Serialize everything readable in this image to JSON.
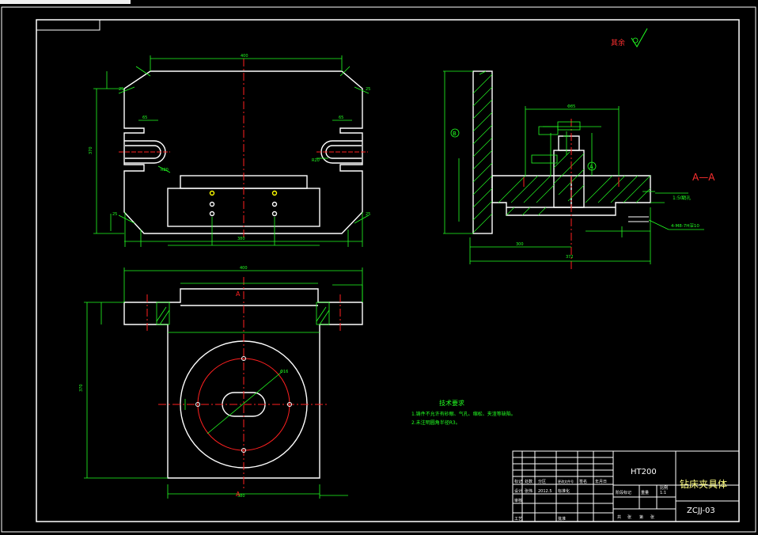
{
  "drawing": {
    "section_label": "A—A",
    "view_marker_a": "A",
    "datum_a": "A",
    "datum_b": "B",
    "surface_note": "其余",
    "ratio_note": "1:50",
    "thread_note": "4-M8-7H深10",
    "hole_note": "销孔",
    "tech_requirements": {
      "title": "技术要求",
      "lines": [
        "1.铸件不允许有砂眼、气孔、缩松、夹渣等缺陷。",
        "2.未注明圆角半径R3。"
      ]
    },
    "dims": {
      "top_width": "400",
      "dia": "Φ16",
      "r20": "R20",
      "d_left": "65",
      "d_right": "65",
      "w_bottom": "380",
      "h_left": "370",
      "section_len": "372",
      "section_sub": "300",
      "section_top": "Φ85",
      "r3": "R3",
      "r5": "R5",
      "c25": "25"
    }
  },
  "title_block": {
    "material": "HT200",
    "part_name": "钻床夹具体",
    "drawing_no": "ZCJJ-03",
    "scale": "1:1",
    "rows": [
      {
        "c1": "标记",
        "c2": "处数",
        "c3": "分区",
        "c4": "更改文件号",
        "c5": "签名",
        "c6": "年月日"
      },
      {
        "c1": "设计",
        "c2": "张伟",
        "c3": "2012.5",
        "c4": "标准化",
        "c5": "",
        "c6": ""
      },
      {
        "c1": "审核",
        "c2": "",
        "c3": "",
        "c4": "",
        "c5": "",
        "c6": ""
      },
      {
        "c1": "工艺",
        "c2": "",
        "c3": "",
        "c4": "批准",
        "c5": "",
        "c6": ""
      }
    ],
    "stage_labels": [
      "阶段标记",
      "重量",
      "比例"
    ],
    "sheet_labels": [
      "共",
      "张",
      "第",
      "张"
    ]
  }
}
